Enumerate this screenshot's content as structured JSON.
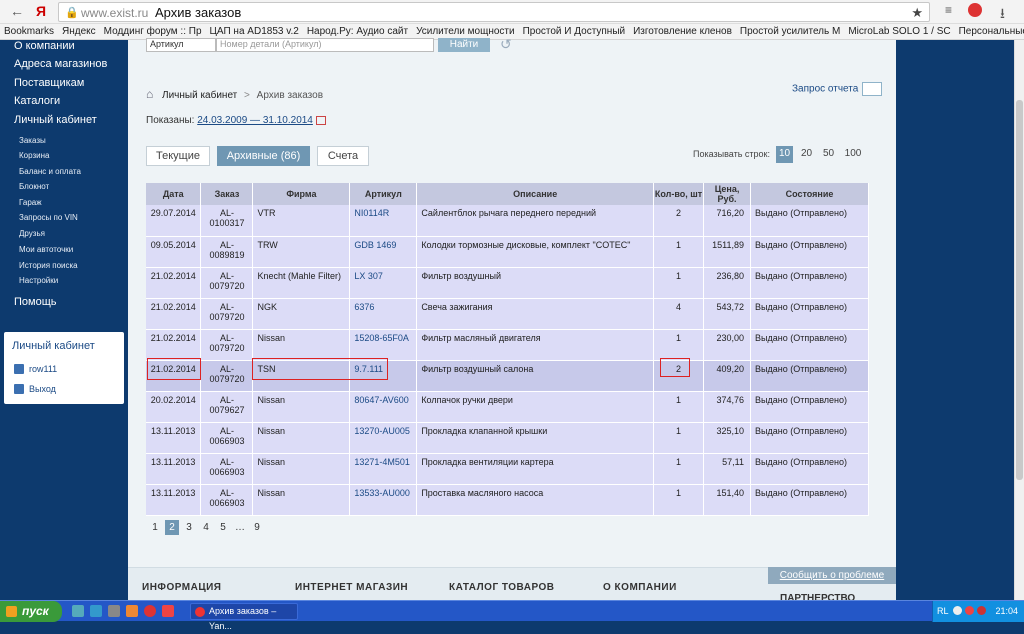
{
  "browser": {
    "domain": "www.exist.ru",
    "title": "Архив заказов",
    "bookmarks": [
      "Bookmarks",
      "Яндекс",
      "Моддинг форум :: Пр",
      "ЦАП на AD1853 v.2",
      "Народ.Ру: Аудио сайт",
      "Усилители мощности",
      "Простой И Доступный",
      "Изготовление кленов",
      "Простой усилитель М",
      "MicroLab SOLO 1 / SC",
      "Персональные Стран"
    ]
  },
  "sidebar": {
    "items": [
      "О компании",
      "Адреса магазинов",
      "Поставщикам",
      "Каталоги",
      "Личный кабинет"
    ],
    "subitems": [
      "Заказы",
      "Корзина",
      "Баланс и оплата",
      "Блокнот",
      "Гараж",
      "Запросы по VIN",
      "Друзья",
      "Мои автоточки",
      "История поиска",
      "Настройки"
    ],
    "help": "Помощь",
    "cabinet": {
      "title": "Личный кабинет",
      "user": "row111",
      "exit": "Выход"
    }
  },
  "search": {
    "select": "Артикул",
    "placeholder": "Номер детали (Артикул)",
    "button": "Найти"
  },
  "breadcrumb": {
    "link": "Личный кабинет",
    "sep": ">",
    "current": "Архив заказов"
  },
  "report_request": "Запрос отчета",
  "shown": {
    "label": "Показаны:",
    "range": "24.03.2009 — 31.10.2014"
  },
  "tabs": [
    {
      "label": "Текущие"
    },
    {
      "label": "Архивные (86)"
    },
    {
      "label": "Счета"
    }
  ],
  "rows_per_page": {
    "label": "Показывать строк:",
    "options": [
      "10",
      "20",
      "50",
      "100"
    ],
    "selected": "10"
  },
  "table": {
    "headers": [
      "Дата",
      "Заказ",
      "Фирма",
      "Артикул",
      "Описание",
      "Кол-во, шт",
      "Цена, Руб.",
      "Состояние"
    ],
    "rows": [
      {
        "date": "29.07.2014",
        "order": "AL-\n0100317",
        "firm": "VTR",
        "article": "NI0114R",
        "desc": "Сайлентблок рычага переднего передний",
        "qty": "2",
        "price": "716,20",
        "status": "Выдано (Отправлено)"
      },
      {
        "date": "09.05.2014",
        "order": "AL-\n0089819",
        "firm": "TRW",
        "article": "GDB 1469",
        "desc": "Колодки тормозные дисковые, комплект \"COTEC\"",
        "qty": "1",
        "price": "1511,89",
        "status": "Выдано (Отправлено)"
      },
      {
        "date": "21.02.2014",
        "order": "AL-\n0079720",
        "firm": "Knecht (Mahle Filter)",
        "article": "LX 307",
        "desc": "Фильтр воздушный",
        "qty": "1",
        "price": "236,80",
        "status": "Выдано (Отправлено)"
      },
      {
        "date": "21.02.2014",
        "order": "AL-\n0079720",
        "firm": "NGK",
        "article": "6376",
        "desc": "Свеча зажигания",
        "qty": "4",
        "price": "543,72",
        "status": "Выдано (Отправлено)"
      },
      {
        "date": "21.02.2014",
        "order": "AL-\n0079720",
        "firm": "Nissan",
        "article": "15208-65F0A",
        "desc": "Фильтр масляный двигателя",
        "qty": "1",
        "price": "230,00",
        "status": "Выдано (Отправлено)"
      },
      {
        "date": "21.02.2014",
        "order": "AL-\n0079720",
        "firm": "TSN",
        "article": "9.7.111",
        "desc": "Фильтр воздушный салона",
        "qty": "2",
        "price": "409,20",
        "status": "Выдано (Отправлено)"
      },
      {
        "date": "20.02.2014",
        "order": "AL-\n0079627",
        "firm": "Nissan",
        "article": "80647-AV600",
        "desc": "Колпачок ручки двери",
        "qty": "1",
        "price": "374,76",
        "status": "Выдано (Отправлено)"
      },
      {
        "date": "13.11.2013",
        "order": "AL-\n0066903",
        "firm": "Nissan",
        "article": "13270-AU005",
        "desc": "Прокладка клапанной крышки",
        "qty": "1",
        "price": "325,10",
        "status": "Выдано (Отправлено)"
      },
      {
        "date": "13.11.2013",
        "order": "AL-\n0066903",
        "firm": "Nissan",
        "article": "13271-4M501",
        "desc": "Прокладка вентиляции картера",
        "qty": "1",
        "price": "57,11",
        "status": "Выдано (Отправлено)"
      },
      {
        "date": "13.11.2013",
        "order": "AL-\n0066903",
        "firm": "Nissan",
        "article": "13533-AU000",
        "desc": "Проставка масляного насоса",
        "qty": "1",
        "price": "151,40",
        "status": "Выдано (Отправлено)"
      }
    ]
  },
  "pager": [
    "1",
    "2",
    "3",
    "4",
    "5",
    "…",
    "9"
  ],
  "footer": {
    "cols": [
      "ИНФОРМАЦИЯ",
      "ИНТЕРНЕТ МАГАЗИН",
      "КАТАЛОГ ТОВАРОВ",
      "О КОМПАНИИ"
    ],
    "report": "Сообщить о проблеме",
    "partner": "ПАРТНЕРСТВО"
  },
  "taskbar": {
    "start": "пуск",
    "task": "Архив заказов – Yan...",
    "lang": "RL",
    "time": "21:04"
  }
}
